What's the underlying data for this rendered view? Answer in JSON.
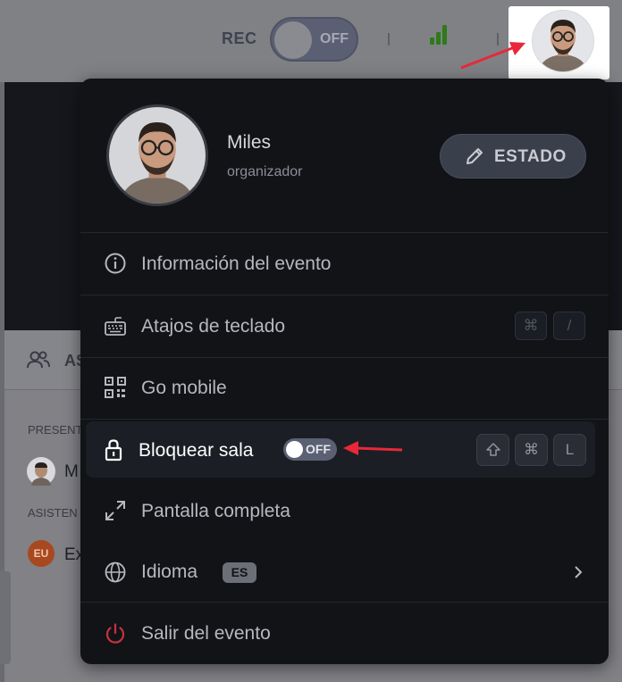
{
  "topbar": {
    "rec_label": "REC",
    "rec_toggle_state": "OFF",
    "signal_color": "#2f7a1a"
  },
  "background": {
    "tab_label": "AS",
    "section_presenters": "PRESENT",
    "presenter_name": "M",
    "section_attendees": "ASISTEN",
    "attendee_initials": "EU",
    "attendee_name": "Ex"
  },
  "profile": {
    "name": "Miles",
    "role": "organizador",
    "status_button_label": "ESTADO"
  },
  "menu": {
    "event_info_label": "Información del evento",
    "shortcuts_label": "Atajos de teclado",
    "shortcuts_keys": [
      "⌘",
      "/"
    ],
    "go_mobile_label": "Go mobile",
    "lock_room_label": "Bloquear sala",
    "lock_room_toggle": "OFF",
    "lock_room_keys": [
      "⇧",
      "⌘",
      "L"
    ],
    "fullscreen_label": "Pantalla completa",
    "language_label": "Idioma",
    "language_code": "ES",
    "leave_label": "Salir del evento"
  },
  "colors": {
    "annotation_arrow": "#e8283a",
    "leave_icon": "#c6333d",
    "menu_bg": "#111317"
  }
}
